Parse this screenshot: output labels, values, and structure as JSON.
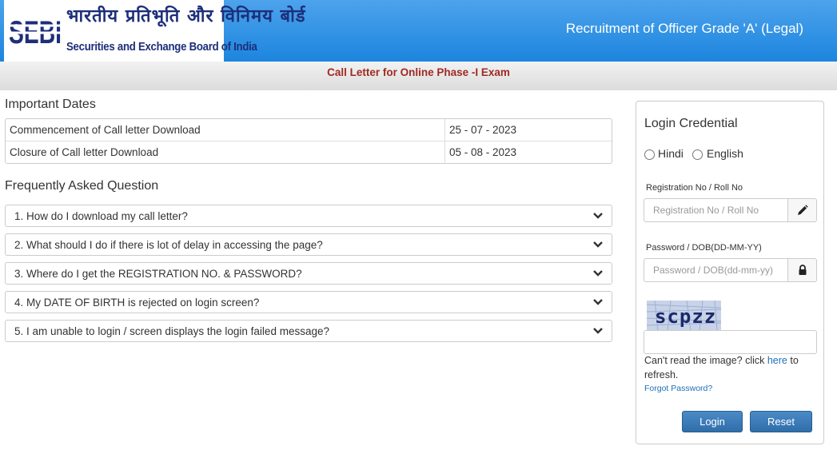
{
  "header": {
    "logo_mark": "SEBI",
    "logo_hindi": "भारतीय प्रतिभूति और विनिमय बोर्ड",
    "logo_english": "Securities and Exchange Board of India",
    "title": "Recruitment of Officer Grade 'A' (Legal)"
  },
  "banner": "Call Letter for Online Phase -I Exam",
  "important_dates": {
    "heading": "Important Dates",
    "rows": [
      {
        "label": "Commencement of Call letter Download",
        "value": "25 - 07 - 2023"
      },
      {
        "label": "Closure of Call letter Download",
        "value": "05 - 08 - 2023"
      }
    ]
  },
  "faq": {
    "heading": "Frequently Asked Question",
    "items": [
      "1. How do I download my call letter?",
      "2. What should I do if there is lot of delay in accessing the page?",
      "3. Where do I get the REGISTRATION NO. & PASSWORD?",
      "4. My DATE OF BIRTH is rejected on login screen?",
      "5. I am unable to login / screen displays the login failed message?"
    ],
    "icon": "chevron-down-icon"
  },
  "login": {
    "title": "Login Credential",
    "languages": [
      "Hindi",
      "English"
    ],
    "registration_label": "Registration No / Roll No",
    "registration_placeholder": "Registration No / Roll No",
    "registration_value": "",
    "registration_icon": "pencil-icon",
    "password_label": "Password / DOB(DD-MM-YY)",
    "password_placeholder": "Password / DOB(dd-mm-yy)",
    "password_value": "",
    "password_icon": "lock-icon",
    "captcha_text": "scpzz",
    "captcha_value": "",
    "captcha_help_prefix": "Can't read the image? click ",
    "captcha_help_link": "here",
    "captcha_help_suffix": " to refresh.",
    "forgot_password": "Forgot Password?",
    "login_button": "Login",
    "reset_button": "Reset"
  },
  "colors": {
    "header_blue": "#1c85de",
    "banner_text": "#a02a22",
    "logo_navy": "#1d2f7a",
    "button_blue": "#3a7bb8",
    "link_blue": "#1e6fb8"
  }
}
